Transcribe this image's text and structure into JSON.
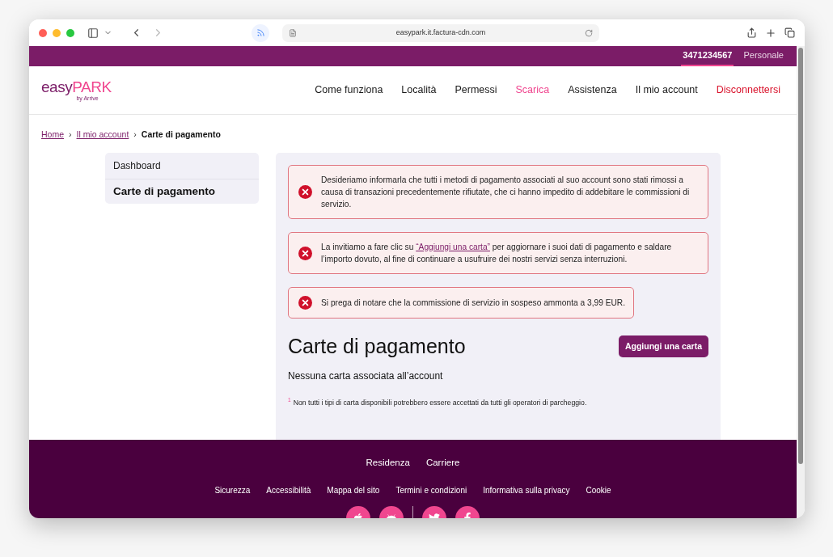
{
  "browser": {
    "url": "easypark.it.factura-cdn.com"
  },
  "top_bar": {
    "items": [
      {
        "label": "3471234567",
        "selected": true
      },
      {
        "label": "Personale",
        "selected": false
      }
    ]
  },
  "logo": {
    "light": "easy",
    "bold": "PARK",
    "tagline": "by Arrive"
  },
  "nav": [
    {
      "label": "Come funziona",
      "kind": "normal"
    },
    {
      "label": "Località",
      "kind": "normal"
    },
    {
      "label": "Permessi",
      "kind": "normal"
    },
    {
      "label": "Scarica",
      "kind": "highlight"
    },
    {
      "label": "Assistenza",
      "kind": "normal"
    },
    {
      "label": "Il mio account",
      "kind": "normal"
    },
    {
      "label": "Disconnettersi",
      "kind": "danger"
    }
  ],
  "breadcrumb": [
    {
      "label": "Home",
      "kind": "link"
    },
    {
      "label": "Il mio account",
      "kind": "link"
    },
    {
      "label": "Carte di pagamento",
      "kind": "current"
    }
  ],
  "breadcrumb_separator": "›",
  "sidebar": {
    "items": [
      {
        "label": "Dashboard",
        "selected": false
      },
      {
        "label": "Carte di pagamento",
        "selected": true
      }
    ]
  },
  "alerts": [
    {
      "text": "Desideriamo informarla che tutti i metodi di pagamento associati al suo account sono stati rimossi a causa di transazioni precedentemente rifiutate, che ci hanno impedito di addebitare le commissioni di servizio."
    },
    {
      "text": "La invitiamo a fare clic su ",
      "link": "“Aggiungi una carta”",
      "text_after": " per aggiornare i suoi dati di pagamento e saldare l’importo dovuto, al fine di continuare a usufruire dei nostri servizi senza interruzioni."
    },
    {
      "text": "Si prega di notare che la commissione di servizio in sospeso ammonta a 3,99 EUR."
    }
  ],
  "heading": "Carte di pagamento",
  "add_button": "Aggiungi una carta",
  "empty_text": "Nessuna carta associata all’account",
  "footnote": {
    "mark": "1",
    "text": "Non tutti i tipi di carta disponibili potrebbero essere accettati da tutti gli operatori di parcheggio."
  },
  "footer": {
    "primary_links": [
      "Residenza",
      "Carriere"
    ],
    "secondary_links": [
      "Sicurezza",
      "Accessibilità",
      "Mappa del sito",
      "Termini e condizioni",
      "Informativa sulla privacy",
      "Cookie"
    ]
  }
}
